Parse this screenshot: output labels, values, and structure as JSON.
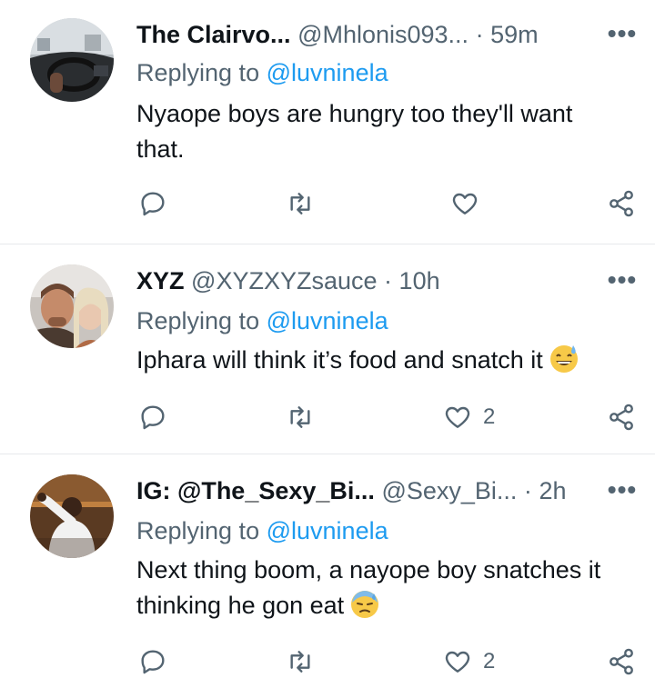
{
  "tweets": [
    {
      "name": "The Clairvo...",
      "handle": "@Mhlonis093...",
      "dot": "·",
      "time": "59m",
      "replying_prefix": "Replying to",
      "replying_to": "@luvninela",
      "text": "Nyaope boys are hungry too they'll want that.",
      "likes": "",
      "avatar": "car-dashboard-avatar"
    },
    {
      "name": "XYZ",
      "handle": "@XYZXYZsauce",
      "dot": "·",
      "time": "10h",
      "replying_prefix": "Replying to",
      "replying_to": "@luvninela",
      "text": "Iphara will think it’s food and snatch it",
      "emoji": "sweat-smile-emoji",
      "likes": "2",
      "avatar": "two-people-avatar"
    },
    {
      "name": "IG: @The_Sexy_Bi...",
      "handle": "@Sexy_Bi...",
      "dot": "·",
      "time": "2h",
      "replying_prefix": "Replying to",
      "replying_to": "@luvninela",
      "text": "Next thing boom, a nayope boy snatches it thinking he gon eat",
      "emoji": "downcast-sweat-emoji",
      "likes": "2",
      "avatar": "man-pointing-avatar"
    }
  ],
  "icons": {
    "more": "more-options-icon",
    "reply": "reply-icon",
    "retweet": "retweet-icon",
    "like": "like-icon",
    "share": "share-icon"
  },
  "more_glyph": "•••",
  "colors": {
    "link": "#1d9bf0",
    "secondary": "#536471",
    "primary_text": "#0f1419",
    "divider": "#e6e9ec"
  }
}
